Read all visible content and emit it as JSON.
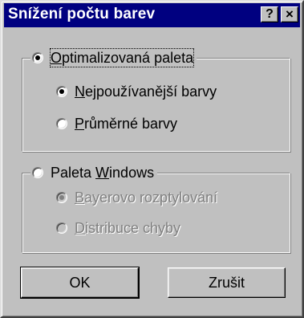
{
  "dialog": {
    "title": "Snížení počtu barev",
    "help_button": "?",
    "close_button": "×"
  },
  "group_palette": {
    "option_label_pre": "",
    "option_label_key": "O",
    "option_label_post": "ptimalizovaná paleta",
    "selected": true,
    "suboptions": [
      {
        "pre": "",
        "key": "N",
        "post": "ejpoužívanější barvy",
        "selected": true,
        "enabled": true
      },
      {
        "pre": "",
        "key": "P",
        "post": "růměrné barvy",
        "selected": false,
        "enabled": true
      }
    ]
  },
  "group_windows": {
    "option_label_pre": "Paleta ",
    "option_label_key": "W",
    "option_label_post": "indows",
    "selected": false,
    "suboptions": [
      {
        "pre": "",
        "key": "B",
        "post": "ayerovo rozptylování",
        "selected": true,
        "enabled": false
      },
      {
        "pre": "",
        "key": "D",
        "post": "istribuce chyby",
        "selected": false,
        "enabled": false
      }
    ]
  },
  "buttons": {
    "ok": "OK",
    "cancel": "Zrušit"
  }
}
